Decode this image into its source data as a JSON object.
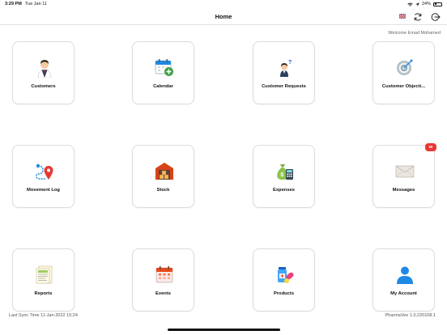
{
  "status_bar": {
    "time": "3:29 PM",
    "date": "Tue Jan 11",
    "battery": "24%"
  },
  "header": {
    "title": "Home",
    "flag_icon": "uk-flag-icon",
    "sync_icon": "sync-icon",
    "logout_icon": "logout-icon"
  },
  "welcome": "Welcome Emad Mohamed",
  "tiles": [
    {
      "label": "Customers",
      "icon": "customer-icon"
    },
    {
      "label": "Calendar",
      "icon": "calendar-icon"
    },
    {
      "label": "Customer Requests",
      "icon": "customer-request-icon"
    },
    {
      "label": "Customer Objecti...",
      "icon": "target-icon"
    },
    {
      "label": "Movement Log",
      "icon": "route-icon"
    },
    {
      "label": "Stock",
      "icon": "warehouse-icon"
    },
    {
      "label": "Expenses",
      "icon": "money-bag-icon"
    },
    {
      "label": "Messages",
      "icon": "envelope-icon",
      "badge": "50"
    },
    {
      "label": "Reports",
      "icon": "report-icon"
    },
    {
      "label": "Events",
      "icon": "events-icon"
    },
    {
      "label": "Products",
      "icon": "products-icon"
    },
    {
      "label": "My Account",
      "icon": "account-icon"
    }
  ],
  "footer": {
    "last_sync": "Last Sync Time 11-Jan-2022 15:24",
    "version": "PharmaVee 1.0.220108.1"
  },
  "colors": {
    "accent": "#1e88e5",
    "badge": "#e53935",
    "border": "#dcdcdc"
  }
}
